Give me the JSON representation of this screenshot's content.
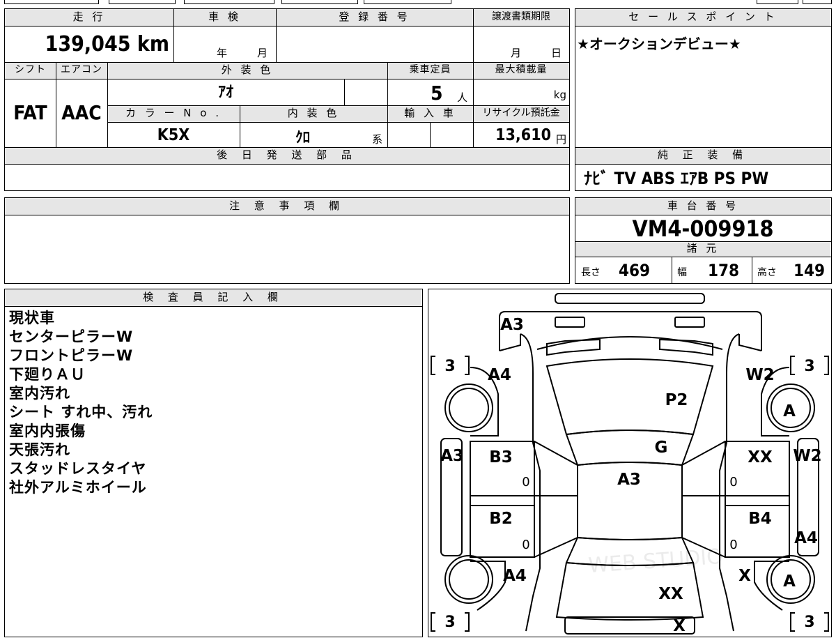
{
  "mileage": {
    "label": "走 行",
    "value": "139,045",
    "unit": "km"
  },
  "inspection": {
    "label": "車 検",
    "year_unit": "年",
    "month_unit": "月"
  },
  "registration": {
    "label": "登 録 番 号",
    "value": ""
  },
  "transfer_deadline": {
    "label": "譲渡書類期限",
    "month_unit": "月",
    "day_unit": "日"
  },
  "sales_point": {
    "label": "セ ー ル ス ポ イ ン ト",
    "text": "★オークションデビュー★"
  },
  "shift": {
    "label": "シフト",
    "value": "FAT"
  },
  "aircon": {
    "label": "エアコン",
    "value": "AAC"
  },
  "exterior_color": {
    "label": "外 装 色",
    "value": "ｱｵ"
  },
  "capacity": {
    "label": "乗車定員",
    "value": "5",
    "unit": "人"
  },
  "max_load": {
    "label": "最大積載量",
    "value": "",
    "unit": "kg"
  },
  "color_no": {
    "label": "カ ラ ー N o .",
    "value": "K5X"
  },
  "interior_color": {
    "label": "内 装 色",
    "value": "ｸﾛ",
    "unit": "系"
  },
  "import": {
    "label": "輸 入 車",
    "value": ""
  },
  "recycle_fee": {
    "label": "リサイクル預託金",
    "value": "13,610",
    "unit": "円"
  },
  "later_parts": {
    "label": "後 日 発 送 部 品",
    "value": ""
  },
  "equipment": {
    "label": "純 正 装 備",
    "value": "ﾅﾋﾞ TV ABS ｴｱB PS PW"
  },
  "notes_field": {
    "label": "注 意 事 項 欄",
    "value": ""
  },
  "chassis_number": {
    "label": "車 台 番 号",
    "value": "VM4-009918"
  },
  "specs": {
    "label": "諸 元",
    "length_label": "長さ",
    "length": "469",
    "width_label": "幅",
    "width": "178",
    "height_label": "高さ",
    "height": "149"
  },
  "inspector": {
    "label": "検 査 員 記 入 欄",
    "notes": [
      "現状車",
      "センターピラーW",
      "フロントピラーW",
      "下廻りＡＵ",
      "室内汚れ",
      "シート すれ中、汚れ",
      "室内内張傷",
      "天張汚れ",
      "スタッドレスタイヤ",
      "社外アルミホイール"
    ]
  },
  "diagram": {
    "tread_fl": "3",
    "tread_fr": "3",
    "tread_rl": "3",
    "tread_rr": "3",
    "tread_zero": "0",
    "marks": {
      "rear_bumper": "A3",
      "front_left_fender": "A4",
      "hood": "P2",
      "front_right_fender": "W2",
      "front_right_wheel": "A",
      "left_front_pillar": "A3",
      "windshield": "G",
      "left_front_door": "B3",
      "roof": "A3",
      "right_front_door": "XX",
      "right_front_pillar": "W2",
      "left_rear_door": "B2",
      "right_rear_door": "B4",
      "right_rear_panel": "A4",
      "left_rear_fender": "A4",
      "trunk": "XX",
      "right_rear_fender": "X",
      "rear_right_wheel": "A",
      "rear_center": "X"
    },
    "watermark": "WEB STUDIO"
  }
}
